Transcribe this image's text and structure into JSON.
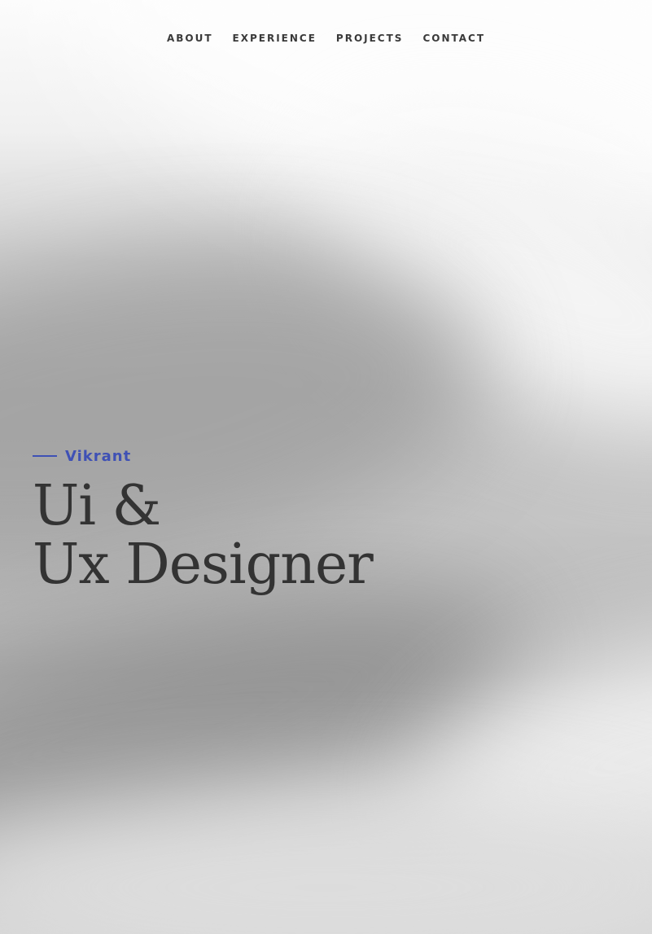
{
  "nav": {
    "items": [
      {
        "label": "ABOUT"
      },
      {
        "label": "EXPERIENCE"
      },
      {
        "label": "PROJECTS"
      },
      {
        "label": "CONTACT"
      }
    ]
  },
  "hero": {
    "name": "Vikrant",
    "title_line1": "Ui &",
    "title_line2": "Ux Designer"
  },
  "colors": {
    "accent": "#3f51b5",
    "text": "#333333"
  }
}
